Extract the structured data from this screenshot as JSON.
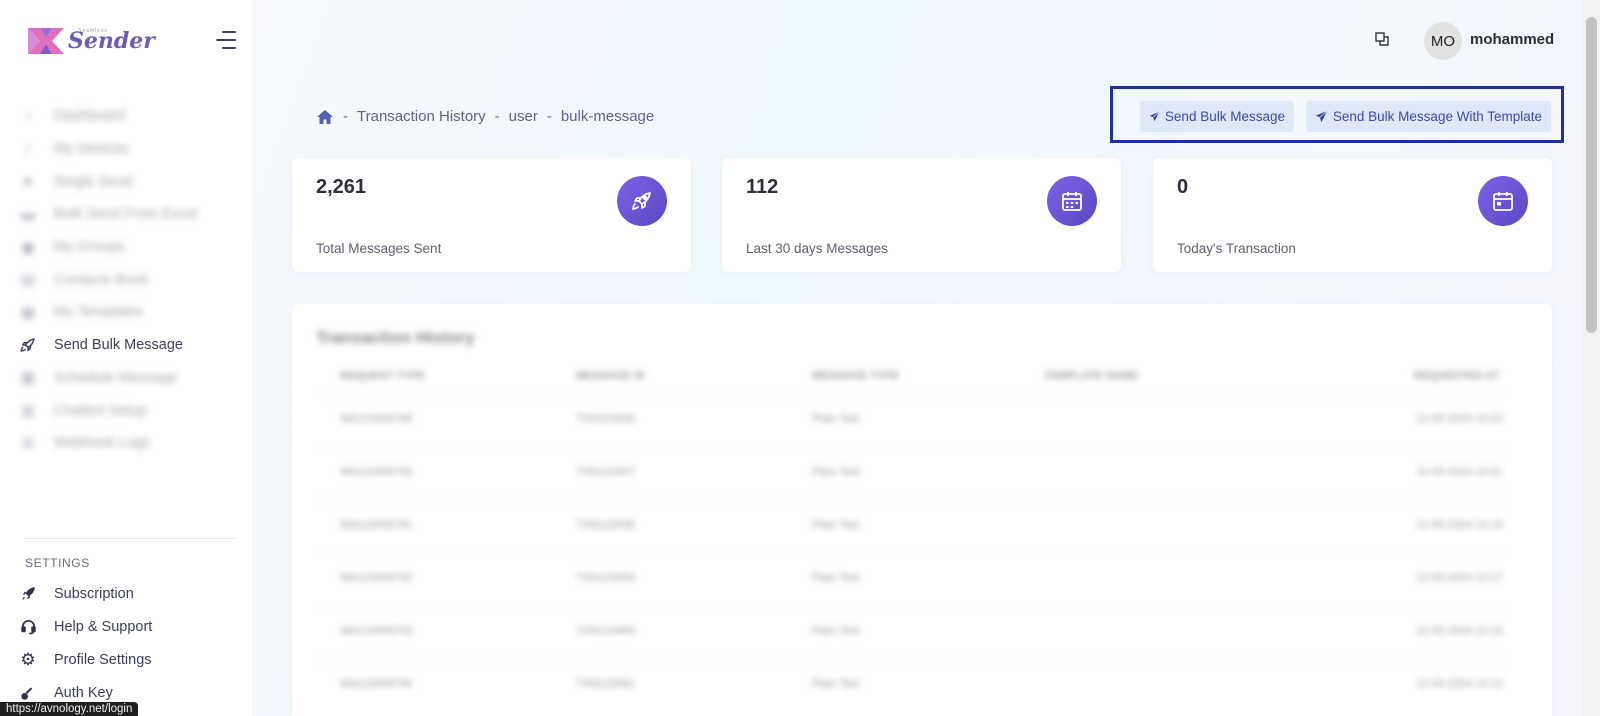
{
  "sidebar": {
    "logo_text": "Sender",
    "logo_sub": "Seamless",
    "items": [
      {
        "label": "Dashboard",
        "icon": "speedometer-icon",
        "blurred": true
      },
      {
        "label": "My Devices",
        "icon": "link-icon",
        "blurred": true
      },
      {
        "label": "Single Send",
        "icon": "send-icon",
        "blurred": true
      },
      {
        "label": "Bulk Send From Excel",
        "icon": "file-icon",
        "blurred": true
      },
      {
        "label": "My Groups",
        "icon": "users-icon",
        "blurred": true
      },
      {
        "label": "Contacts Book",
        "icon": "book-icon",
        "blurred": true
      },
      {
        "label": "My Templates",
        "icon": "template-icon",
        "blurred": true
      },
      {
        "label": "Send Bulk Message",
        "icon": "rocket-icon",
        "blurred": false
      },
      {
        "label": "Schedule Message",
        "icon": "calendar-icon",
        "blurred": true
      },
      {
        "label": "Chatbot Setup",
        "icon": "robot-icon",
        "blurred": true
      },
      {
        "label": "Webhook Logs",
        "icon": "log-icon",
        "blurred": true
      }
    ],
    "settings_title": "SETTINGS",
    "settings_items": [
      {
        "label": "Subscription",
        "icon": "rocket-icon"
      },
      {
        "label": "Help & Support",
        "icon": "headset-icon"
      },
      {
        "label": "Profile Settings",
        "icon": "gear-icon"
      },
      {
        "label": "Auth Key",
        "icon": "key-icon"
      }
    ]
  },
  "status_url": "https://avnology.net/login",
  "topbar": {
    "avatar_initials": "MO",
    "username": "mohammed"
  },
  "breadcrumb": {
    "items": [
      "Transaction History",
      "user",
      "bulk-message"
    ],
    "separator": "-"
  },
  "actions": {
    "send_bulk": "Send Bulk Message",
    "send_bulk_template": "Send Bulk Message With Template"
  },
  "cards": [
    {
      "value": "2,261",
      "label": "Total Messages Sent",
      "icon": "rocket-icon"
    },
    {
      "value": "112",
      "label": "Last 30 days Messages",
      "icon": "calendar-icon"
    },
    {
      "value": "0",
      "label": "Today's Transaction",
      "icon": "calendar-small-icon"
    }
  ],
  "table": {
    "title": "Transaction History",
    "headers": [
      "REQUEST TYPE",
      "MESSAGE ID",
      "MESSAGE TYPE",
      "TEMPLATE NAME",
      "REQUESTED AT"
    ],
    "rows": [
      [
        "WA123456789",
        "TXN123456",
        "Plain Text",
        "",
        "12-05-2024 10:23"
      ],
      [
        "WA123456790",
        "TXN123457",
        "Plain Text",
        "",
        "12-05-2024 10:21"
      ],
      [
        "WA123456791",
        "TXN123458",
        "Plain Text",
        "",
        "12-05-2024 10:19"
      ],
      [
        "WA123456792",
        "TXN123459",
        "Plain Text",
        "",
        "12-05-2024 10:17"
      ],
      [
        "WA123456793",
        "TXN123460",
        "Plain Text",
        "",
        "12-05-2024 10:15"
      ],
      [
        "WA123456794",
        "TXN123461",
        "Plain Text",
        "",
        "12-05-2024 10:13"
      ]
    ]
  },
  "colors": {
    "accent": "#6b53d6",
    "button_bg": "#dde8fb",
    "highlight_border": "#1e2fa0"
  }
}
